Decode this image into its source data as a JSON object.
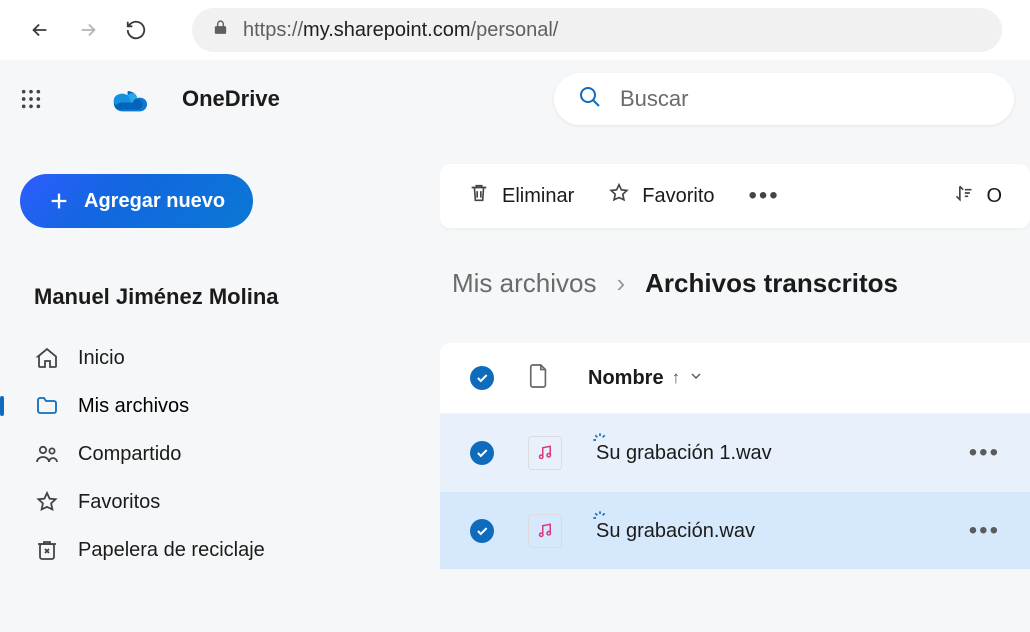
{
  "browser": {
    "url_prefix": "https://",
    "url_host": "my.sharepoint.com",
    "url_path": "/personal/"
  },
  "app_title": "OneDrive",
  "search": {
    "placeholder": "Buscar"
  },
  "add_new_label": "Agregar nuevo",
  "user_name": "Manuel Jiménez Molina",
  "nav": {
    "home": "Inicio",
    "my_files": "Mis archivos",
    "shared": "Compartido",
    "favorites": "Favoritos",
    "recycle": "Papelera de reciclaje"
  },
  "toolbar": {
    "delete": "Eliminar",
    "favorite": "Favorito",
    "sort_letter": "O"
  },
  "breadcrumb": {
    "root": "Mis archivos",
    "sep": "›",
    "current": "Archivos transcritos"
  },
  "columns": {
    "name": "Nombre"
  },
  "files": [
    {
      "name": "Su grabación 1.wav"
    },
    {
      "name": "Su grabación.wav"
    }
  ]
}
